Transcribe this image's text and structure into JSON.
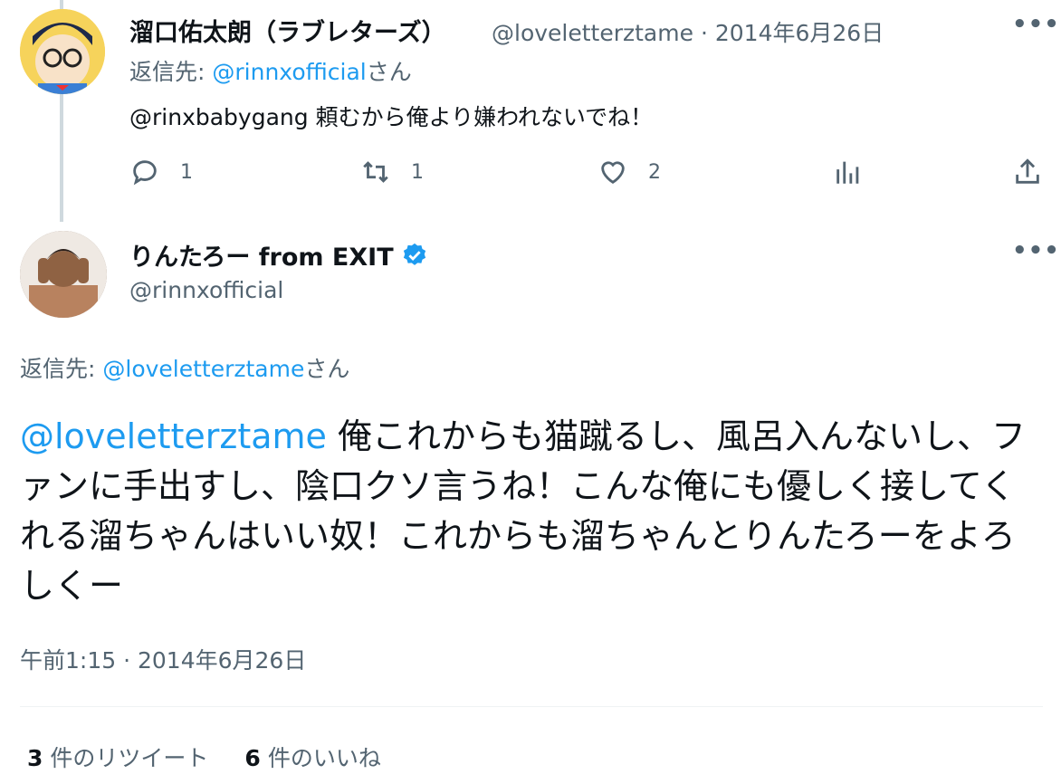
{
  "parent_tweet": {
    "display_name": "溜口佑太朗（ラブレターズ）",
    "handle": "@loveletterztame",
    "separator": "·",
    "date": "2014年6月26日",
    "reply_prefix": "返信先: ",
    "reply_to": "@rinnxofficial",
    "reply_suffix": "さん",
    "text": "@rinxbabygang 頼むから俺より嫌われないでね！",
    "actions": {
      "reply_count": "1",
      "retweet_count": "1",
      "like_count": "2"
    }
  },
  "main_tweet": {
    "display_name": "りんたろー from EXIT",
    "verified_icon": "verified-badge-icon",
    "handle": "@rinnxofficial",
    "reply_prefix": "返信先: ",
    "reply_to": "@loveletterztame",
    "reply_suffix": "さん",
    "mention": "@loveletterztame",
    "text": " 俺これからも猫蹴るし、風呂入んないし、ファンに手出すし、陰口クソ言うね！こんな俺にも優しく接してくれる溜ちゃんはいい奴！これからも溜ちゃんとりんたろーをよろしくー",
    "time": "午前1:15 · 2014年6月26日",
    "retweets": {
      "count": "3",
      "label": "件のリツイート"
    },
    "likes": {
      "count": "6",
      "label": "件のいいね"
    }
  },
  "icons": [
    "more-icon",
    "reply-icon",
    "retweet-icon",
    "like-icon",
    "analytics-icon",
    "share-icon",
    "verified-badge-icon"
  ],
  "colors": {
    "accent": "#1d9bf0",
    "secondary_text": "#536471",
    "text": "#0f1419",
    "thread_line": "#cfd9de"
  }
}
